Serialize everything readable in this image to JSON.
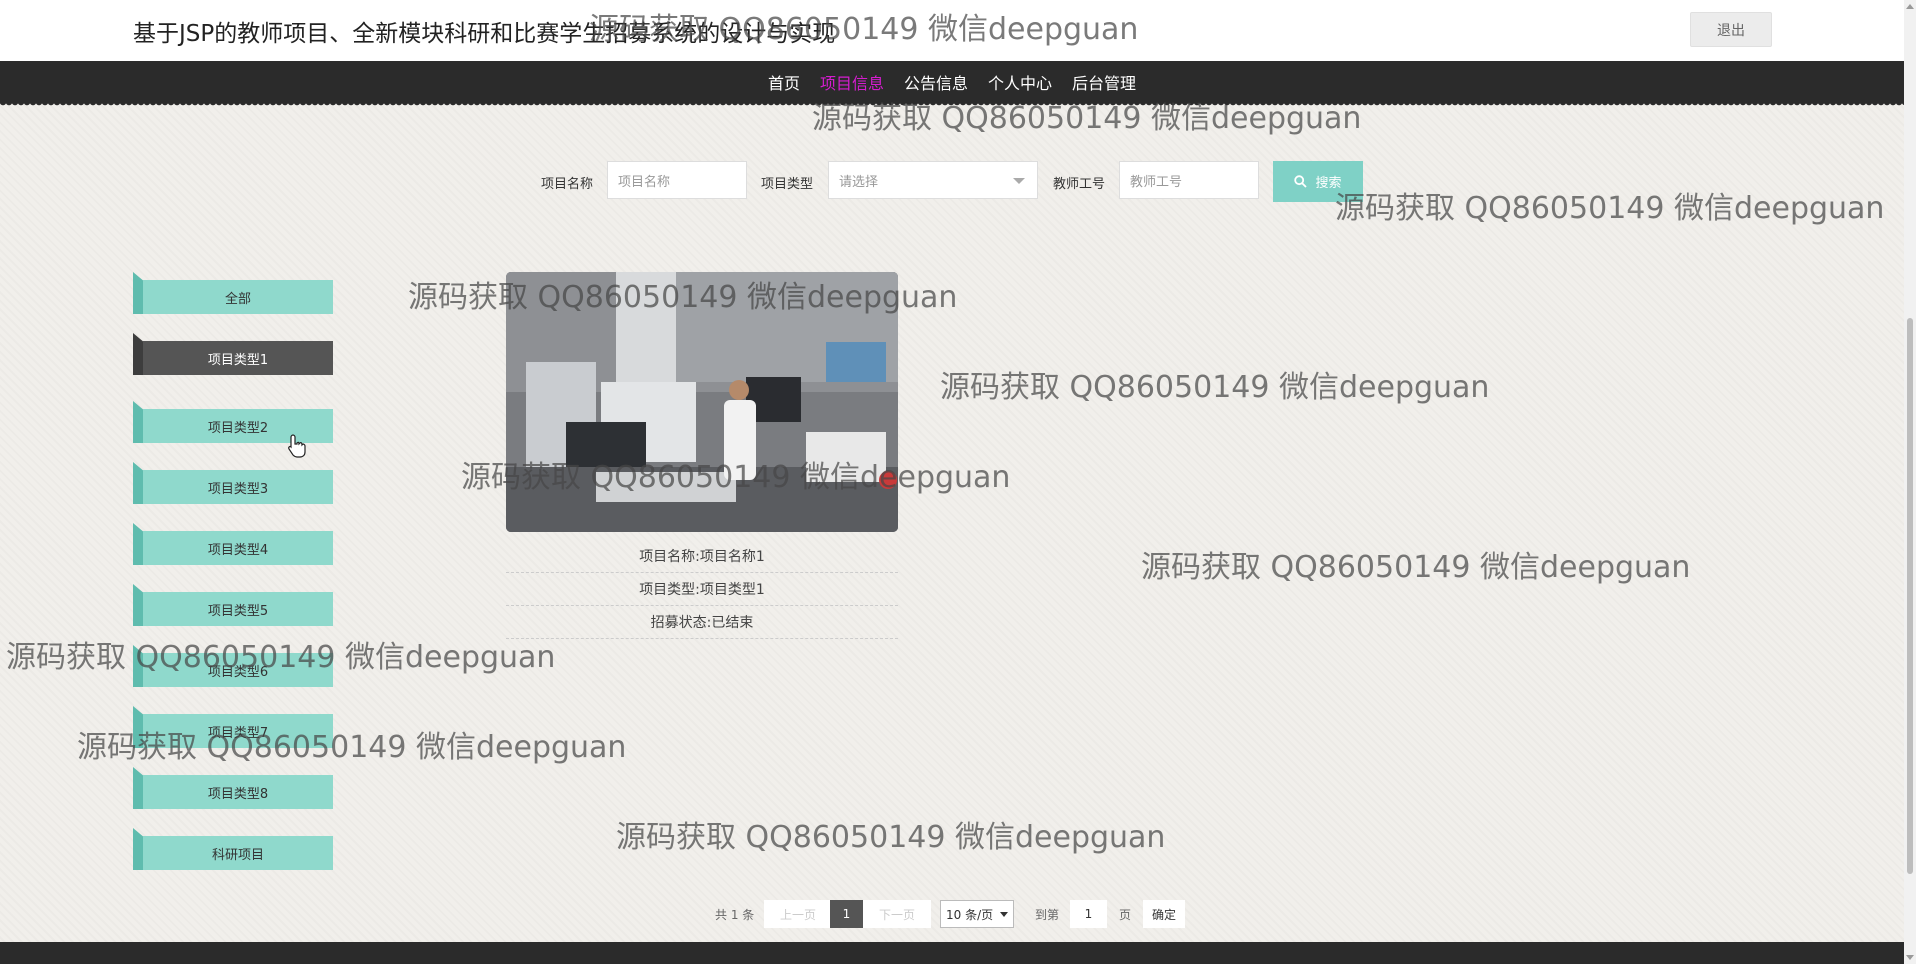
{
  "header": {
    "title": "基于JSP的教师项目、全新模块科研和比赛学生招募系统的设计与实现",
    "logout_label": "退出"
  },
  "nav": {
    "items": [
      "首页",
      "项目信息",
      "公告信息",
      "个人中心",
      "后台管理"
    ],
    "active_index": 1
  },
  "search": {
    "name_label": "项目名称",
    "name_placeholder": "项目名称",
    "type_label": "项目类型",
    "type_value": "请选择",
    "teacher_label": "教师工号",
    "teacher_placeholder": "教师工号",
    "button_label": "搜索"
  },
  "categories": {
    "items": [
      "全部",
      "项目类型1",
      "项目类型2",
      "项目类型3",
      "项目类型4",
      "项目类型5",
      "项目类型6",
      "项目类型7",
      "项目类型8",
      "科研项目"
    ],
    "active_index": 1
  },
  "project": {
    "name_row": "项目名称:项目名称1",
    "type_row": "项目类型:项目类型1",
    "status_row": "招募状态:已结束"
  },
  "pagination": {
    "total": "共 1 条",
    "prev": "上一页",
    "current_page": "1",
    "next": "下一页",
    "page_size": "10 条/页",
    "goto_label": "到第",
    "goto_value": "1",
    "page_suffix": "页",
    "confirm": "确定"
  },
  "watermark": "源码获取 QQ86050149 微信deepguan",
  "colors": {
    "accent_teal": "#8fd9cc",
    "nav_active": "#d61cd0",
    "nav_bg": "#2b2b2b"
  }
}
